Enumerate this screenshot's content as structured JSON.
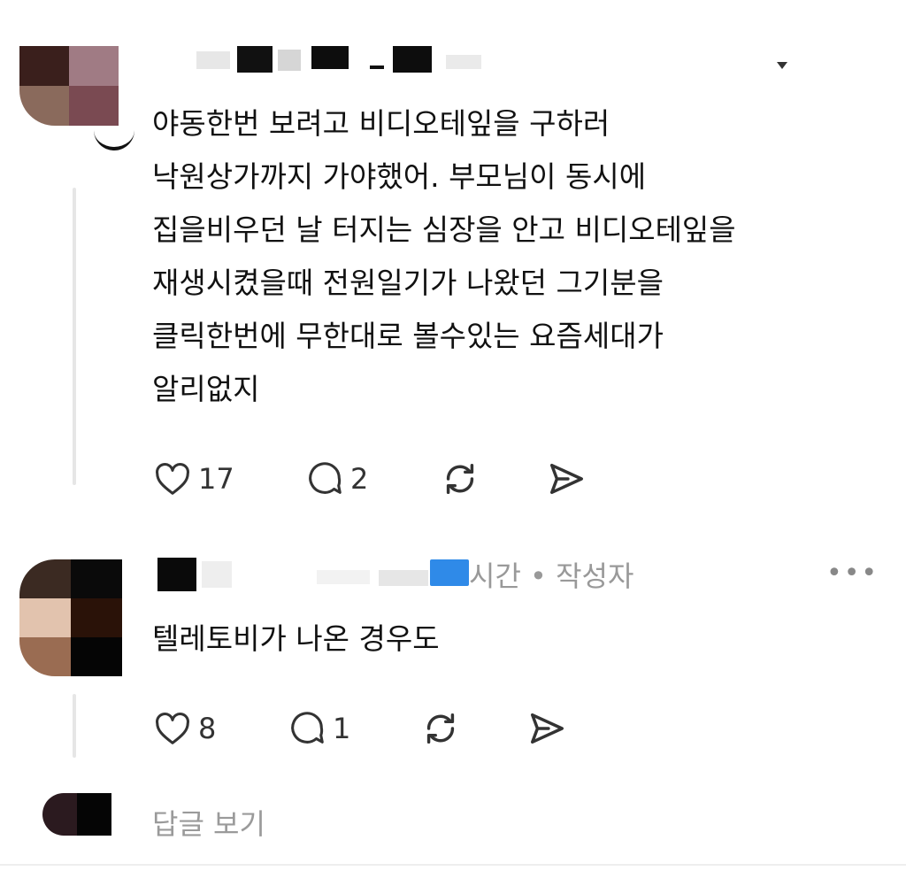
{
  "comment1": {
    "text": "야동한번 보려고  비디오테잎을 구하러\n낙원상가까지 가야했어. 부모님이 동시에\n집을비우던 날 터지는 심장을 안고 비디오테잎을\n재생시켰을때 전원일기가 나왔던 그기분을\n클릭한번에 무한대로 볼수있는 요즘세대가\n알리없지",
    "likes": "17",
    "replies": "2",
    "avatar_colors": [
      "#3a1f1c",
      "#a07b84",
      "#8a6a5c",
      "#7a4a52"
    ]
  },
  "comment2": {
    "meta": "시간 • 작성자",
    "text": "텔레토비가 나온 경우도",
    "likes": "8",
    "replies": "1",
    "avatar_colors": [
      "#3b2a22",
      "#0a0a0a",
      "#e2c3ae",
      "#2a1208",
      "#9a6c52",
      "#050505"
    ]
  },
  "view_replies": "답글 보기",
  "more_label": "•••",
  "icons": {
    "like": "heart-icon",
    "reply": "comment-bubble-icon",
    "repost": "repost-icon",
    "share": "send-icon",
    "more": "more-dots-icon",
    "mention": "blue-tag-icon"
  }
}
